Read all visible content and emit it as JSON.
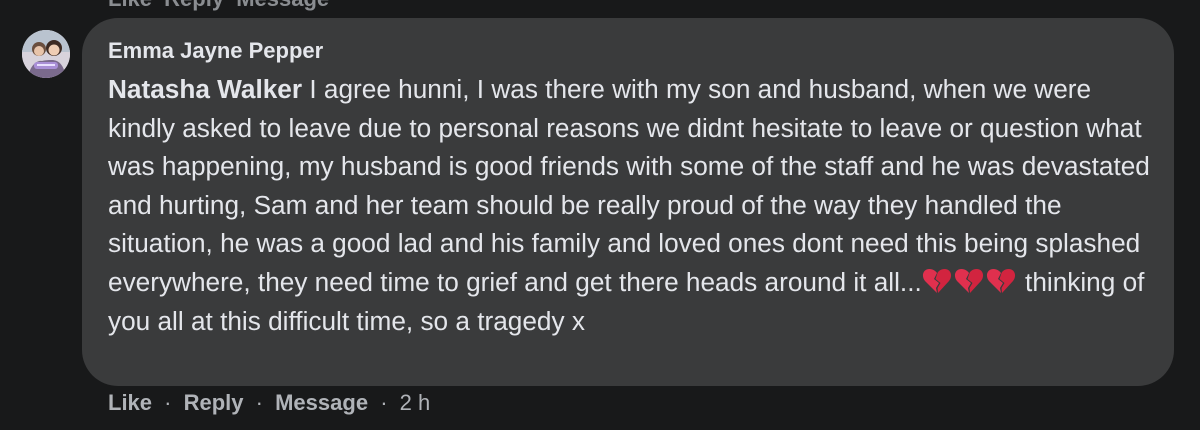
{
  "previous_comment_actions": {
    "like": "Like",
    "reply": "Reply",
    "message": "Message"
  },
  "comment": {
    "author": "Emma Jayne Pepper",
    "mention": "Natasha Walker",
    "text_before_hearts": " I agree hunni, I was there with my son and husband, when we were kindly asked to leave due to personal reasons we didnt hesitate to leave or question what was happening, my husband is good friends with some of the staff and he was devastated and hurting, Sam and her team should be really proud of the way they handled the situation, he was a good lad and his family and loved ones dont need this being splashed everywhere, they need time to grief and get there heads around it all...",
    "text_after_hearts": " thinking of you all at this difficult time, so a tragedy x",
    "emoji_icon": "broken-heart-icon",
    "emoji_color": "#e0304e"
  },
  "actions": {
    "like": "Like",
    "reply": "Reply",
    "message": "Message",
    "time": "2 h",
    "separator": "·"
  },
  "colors": {
    "background": "#18191a",
    "bubble": "#3a3b3c",
    "text": "#e4e6eb",
    "secondary_text": "#b0b3b8"
  }
}
